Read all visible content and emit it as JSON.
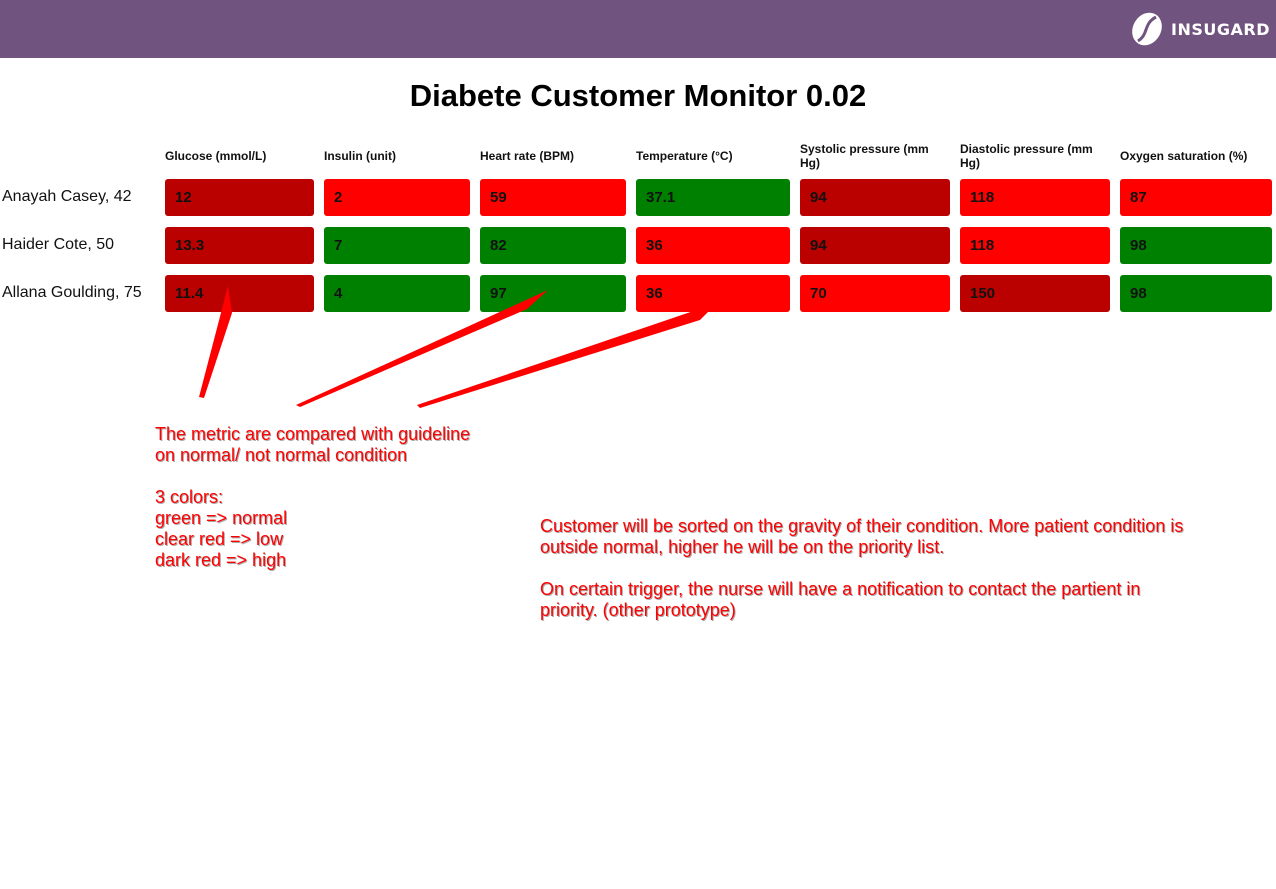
{
  "header": {
    "brand": "INSUGARD",
    "logo_icon": "coffee-bean-icon",
    "bar_color": "#70547f"
  },
  "page_title": "Diabete Customer Monitor 0.02",
  "columns": [
    "Glucose (mmol/L)",
    "Insulin (unit)",
    "Heart rate (BPM)",
    "Temperature (°C)",
    "Systolic pressure (mm Hg)",
    "Diastolic pressure (mm Hg)",
    "Oxygen saturation (%)"
  ],
  "status_colors": {
    "normal": "#008000",
    "low": "#ff0000",
    "high": "#bb0000"
  },
  "patients": [
    {
      "name": "Anayah Casey, 42",
      "metrics": [
        {
          "value": "12",
          "status": "high"
        },
        {
          "value": "2",
          "status": "low"
        },
        {
          "value": "59",
          "status": "low"
        },
        {
          "value": "37.1",
          "status": "normal"
        },
        {
          "value": "94",
          "status": "high"
        },
        {
          "value": "118",
          "status": "low"
        },
        {
          "value": "87",
          "status": "low"
        }
      ]
    },
    {
      "name": "Haider Cote, 50",
      "metrics": [
        {
          "value": "13.3",
          "status": "high"
        },
        {
          "value": "7",
          "status": "normal"
        },
        {
          "value": "82",
          "status": "normal"
        },
        {
          "value": "36",
          "status": "low"
        },
        {
          "value": "94",
          "status": "high"
        },
        {
          "value": "118",
          "status": "low"
        },
        {
          "value": "98",
          "status": "normal"
        }
      ]
    },
    {
      "name": "Allana Goulding, 75",
      "metrics": [
        {
          "value": "11.4",
          "status": "high"
        },
        {
          "value": "4",
          "status": "normal"
        },
        {
          "value": "97",
          "status": "normal"
        },
        {
          "value": "36",
          "status": "low"
        },
        {
          "value": "70",
          "status": "low"
        },
        {
          "value": "150",
          "status": "high"
        },
        {
          "value": "98",
          "status": "normal"
        }
      ]
    }
  ],
  "annotations": {
    "legend_note": "The metric are compared with guideline\non normal/ not normal condition\n\n3 colors:\ngreen => normal\nclear red => low\ndark red => high",
    "priority_note": "Customer will be sorted on the gravity of their condition. More patient condition is\noutside normal, higher he will be on the priority list.\n\nOn certain trigger, the nurse will have a notification to contact the partient in\npriority. (other prototype)",
    "annotation_color": "#ff0000"
  }
}
